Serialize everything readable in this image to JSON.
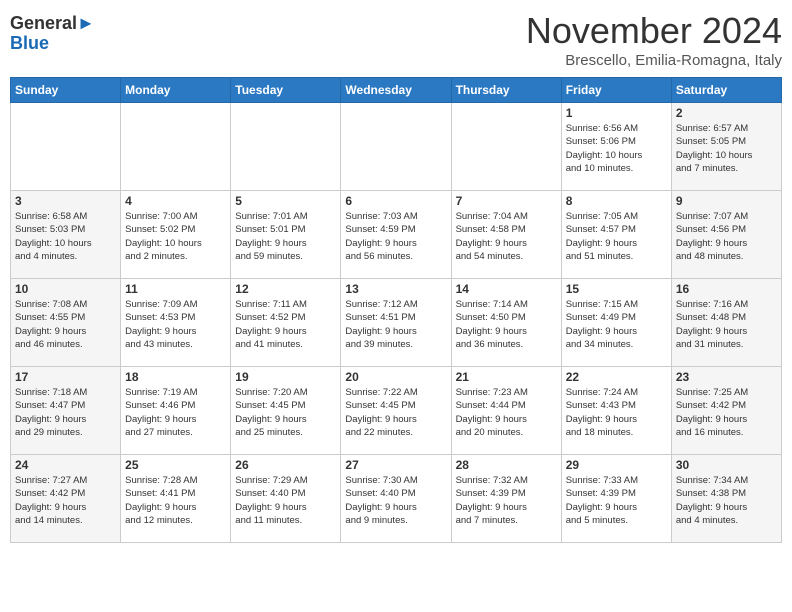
{
  "header": {
    "logo": {
      "line1": "General",
      "line2": "Blue"
    },
    "title": "November 2024",
    "location": "Brescello, Emilia-Romagna, Italy"
  },
  "calendar": {
    "weekdays": [
      "Sunday",
      "Monday",
      "Tuesday",
      "Wednesday",
      "Thursday",
      "Friday",
      "Saturday"
    ],
    "weeks": [
      [
        {
          "day": "",
          "info": ""
        },
        {
          "day": "",
          "info": ""
        },
        {
          "day": "",
          "info": ""
        },
        {
          "day": "",
          "info": ""
        },
        {
          "day": "",
          "info": ""
        },
        {
          "day": "1",
          "info": "Sunrise: 6:56 AM\nSunset: 5:06 PM\nDaylight: 10 hours\nand 10 minutes."
        },
        {
          "day": "2",
          "info": "Sunrise: 6:57 AM\nSunset: 5:05 PM\nDaylight: 10 hours\nand 7 minutes."
        }
      ],
      [
        {
          "day": "3",
          "info": "Sunrise: 6:58 AM\nSunset: 5:03 PM\nDaylight: 10 hours\nand 4 minutes."
        },
        {
          "day": "4",
          "info": "Sunrise: 7:00 AM\nSunset: 5:02 PM\nDaylight: 10 hours\nand 2 minutes."
        },
        {
          "day": "5",
          "info": "Sunrise: 7:01 AM\nSunset: 5:01 PM\nDaylight: 9 hours\nand 59 minutes."
        },
        {
          "day": "6",
          "info": "Sunrise: 7:03 AM\nSunset: 4:59 PM\nDaylight: 9 hours\nand 56 minutes."
        },
        {
          "day": "7",
          "info": "Sunrise: 7:04 AM\nSunset: 4:58 PM\nDaylight: 9 hours\nand 54 minutes."
        },
        {
          "day": "8",
          "info": "Sunrise: 7:05 AM\nSunset: 4:57 PM\nDaylight: 9 hours\nand 51 minutes."
        },
        {
          "day": "9",
          "info": "Sunrise: 7:07 AM\nSunset: 4:56 PM\nDaylight: 9 hours\nand 48 minutes."
        }
      ],
      [
        {
          "day": "10",
          "info": "Sunrise: 7:08 AM\nSunset: 4:55 PM\nDaylight: 9 hours\nand 46 minutes."
        },
        {
          "day": "11",
          "info": "Sunrise: 7:09 AM\nSunset: 4:53 PM\nDaylight: 9 hours\nand 43 minutes."
        },
        {
          "day": "12",
          "info": "Sunrise: 7:11 AM\nSunset: 4:52 PM\nDaylight: 9 hours\nand 41 minutes."
        },
        {
          "day": "13",
          "info": "Sunrise: 7:12 AM\nSunset: 4:51 PM\nDaylight: 9 hours\nand 39 minutes."
        },
        {
          "day": "14",
          "info": "Sunrise: 7:14 AM\nSunset: 4:50 PM\nDaylight: 9 hours\nand 36 minutes."
        },
        {
          "day": "15",
          "info": "Sunrise: 7:15 AM\nSunset: 4:49 PM\nDaylight: 9 hours\nand 34 minutes."
        },
        {
          "day": "16",
          "info": "Sunrise: 7:16 AM\nSunset: 4:48 PM\nDaylight: 9 hours\nand 31 minutes."
        }
      ],
      [
        {
          "day": "17",
          "info": "Sunrise: 7:18 AM\nSunset: 4:47 PM\nDaylight: 9 hours\nand 29 minutes."
        },
        {
          "day": "18",
          "info": "Sunrise: 7:19 AM\nSunset: 4:46 PM\nDaylight: 9 hours\nand 27 minutes."
        },
        {
          "day": "19",
          "info": "Sunrise: 7:20 AM\nSunset: 4:45 PM\nDaylight: 9 hours\nand 25 minutes."
        },
        {
          "day": "20",
          "info": "Sunrise: 7:22 AM\nSunset: 4:45 PM\nDaylight: 9 hours\nand 22 minutes."
        },
        {
          "day": "21",
          "info": "Sunrise: 7:23 AM\nSunset: 4:44 PM\nDaylight: 9 hours\nand 20 minutes."
        },
        {
          "day": "22",
          "info": "Sunrise: 7:24 AM\nSunset: 4:43 PM\nDaylight: 9 hours\nand 18 minutes."
        },
        {
          "day": "23",
          "info": "Sunrise: 7:25 AM\nSunset: 4:42 PM\nDaylight: 9 hours\nand 16 minutes."
        }
      ],
      [
        {
          "day": "24",
          "info": "Sunrise: 7:27 AM\nSunset: 4:42 PM\nDaylight: 9 hours\nand 14 minutes."
        },
        {
          "day": "25",
          "info": "Sunrise: 7:28 AM\nSunset: 4:41 PM\nDaylight: 9 hours\nand 12 minutes."
        },
        {
          "day": "26",
          "info": "Sunrise: 7:29 AM\nSunset: 4:40 PM\nDaylight: 9 hours\nand 11 minutes."
        },
        {
          "day": "27",
          "info": "Sunrise: 7:30 AM\nSunset: 4:40 PM\nDaylight: 9 hours\nand 9 minutes."
        },
        {
          "day": "28",
          "info": "Sunrise: 7:32 AM\nSunset: 4:39 PM\nDaylight: 9 hours\nand 7 minutes."
        },
        {
          "day": "29",
          "info": "Sunrise: 7:33 AM\nSunset: 4:39 PM\nDaylight: 9 hours\nand 5 minutes."
        },
        {
          "day": "30",
          "info": "Sunrise: 7:34 AM\nSunset: 4:38 PM\nDaylight: 9 hours\nand 4 minutes."
        }
      ]
    ]
  }
}
